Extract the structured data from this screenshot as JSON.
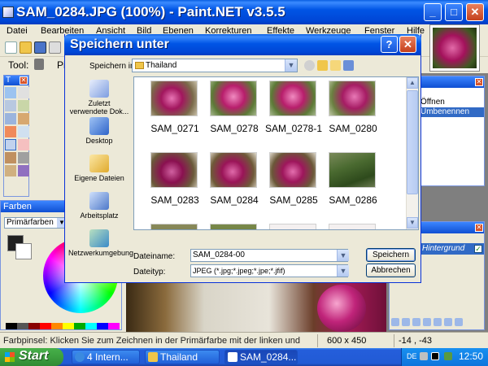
{
  "main": {
    "title": "SAM_0284.JPG (100%) - Paint.NET v3.5.5",
    "menu": [
      "Datei",
      "Bearbeiten",
      "Ansicht",
      "Bild",
      "Ebenen",
      "Korrekturen",
      "Effekte",
      "Werkzeuge",
      "Fenster",
      "Hilfe"
    ],
    "tool_label": "Tool:",
    "tool_label2": "Pi"
  },
  "panels": {
    "tools_title": "T",
    "colors_title": "Farben",
    "color_mode": "Primärfarben",
    "history_items": [
      "",
      "Öffnen",
      "Umbenennen"
    ],
    "layer_name": "Hintergrund"
  },
  "status": {
    "hint": "Farbpinsel: Klicken Sie zum Zeichnen in der Primärfarbe mit der linken und",
    "size": "600 x 450",
    "coords": "-14 , -43"
  },
  "dialog": {
    "title": "Speichern unter",
    "save_in_label": "Speichern in:",
    "save_in_value": "Thailand",
    "places": [
      {
        "label": "Zuletzt verwendete Dok..."
      },
      {
        "label": "Desktop"
      },
      {
        "label": "Eigene Dateien"
      },
      {
        "label": "Arbeitsplatz"
      },
      {
        "label": "Netzwerkumgebung"
      }
    ],
    "files": [
      "SAM_0271",
      "SAM_0278",
      "SAM_0278-1",
      "SAM_0280",
      "SAM_0283",
      "SAM_0284",
      "SAM_0285",
      "SAM_0286",
      "",
      "",
      "",
      ""
    ],
    "filename_label": "Dateiname:",
    "filename_value": "SAM_0284-00",
    "filetype_label": "Dateityp:",
    "filetype_value": "JPEG (*.jpg;*.jpeg;*.jpe;*.jfif)",
    "save_button": "Speichern",
    "cancel_button": "Abbrechen"
  },
  "taskbar": {
    "start": "Start",
    "tasks": [
      "4 Intern...",
      "Thailand",
      "SAM_0284..."
    ],
    "lang": "DE",
    "clock": "12:50"
  }
}
